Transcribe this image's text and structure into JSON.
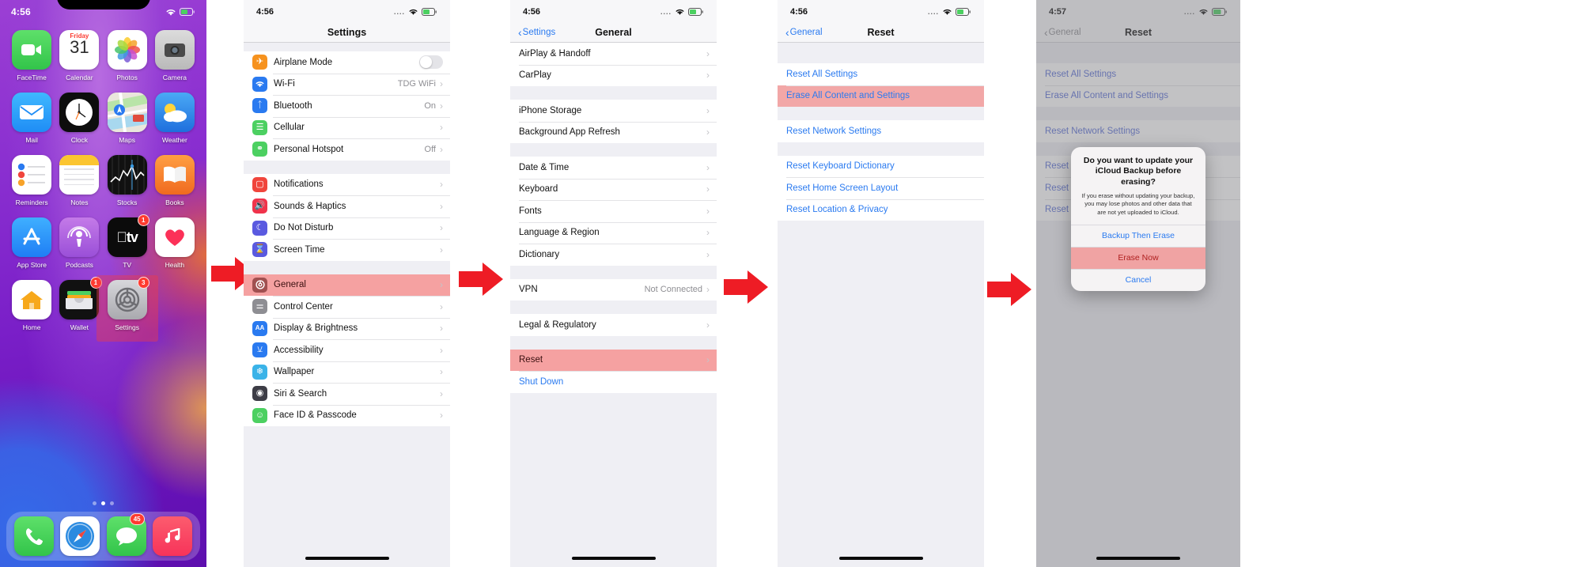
{
  "phone1": {
    "name": "home-screen",
    "status": {
      "time": "4:56",
      "wifi_icon": "wifi-icon",
      "battery_icon": "battery-icon"
    },
    "apps": [
      {
        "label": "FaceTime",
        "icon": "facetime-icon"
      },
      {
        "label": "Calendar",
        "icon": "calendar-icon",
        "weekday": "Friday",
        "day": "31"
      },
      {
        "label": "Photos",
        "icon": "photos-icon"
      },
      {
        "label": "Camera",
        "icon": "camera-icon"
      },
      {
        "label": "Mail",
        "icon": "mail-icon"
      },
      {
        "label": "Clock",
        "icon": "clock-icon"
      },
      {
        "label": "Maps",
        "icon": "maps-icon"
      },
      {
        "label": "Weather",
        "icon": "weather-icon"
      },
      {
        "label": "Reminders",
        "icon": "reminders-icon"
      },
      {
        "label": "Notes",
        "icon": "notes-icon"
      },
      {
        "label": "Stocks",
        "icon": "stocks-icon"
      },
      {
        "label": "Books",
        "icon": "books-icon"
      },
      {
        "label": "App Store",
        "icon": "appstore-icon"
      },
      {
        "label": "Podcasts",
        "icon": "podcasts-icon"
      },
      {
        "label": "TV",
        "icon": "tv-icon",
        "badge": "1"
      },
      {
        "label": "Health",
        "icon": "health-icon"
      },
      {
        "label": "Home",
        "icon": "home-icon"
      },
      {
        "label": "Wallet",
        "icon": "wallet-icon",
        "badge": "1"
      },
      {
        "label": "Settings",
        "icon": "settings-icon",
        "badge": "3",
        "highlighted": true
      }
    ],
    "dock": [
      {
        "label": "Phone",
        "icon": "phone-icon"
      },
      {
        "label": "Safari",
        "icon": "safari-icon"
      },
      {
        "label": "Messages",
        "icon": "messages-icon",
        "badge": "45"
      },
      {
        "label": "Music",
        "icon": "music-icon"
      }
    ],
    "page_dots": {
      "count": 3,
      "active_index": 1
    }
  },
  "phone2": {
    "name": "settings-screen",
    "status": {
      "time": "4:56"
    },
    "nav": {
      "title": "Settings",
      "back": ""
    },
    "groups": [
      {
        "rows": [
          {
            "label": "Airplane Mode",
            "icon": "airplane-icon",
            "control": "toggle",
            "toggle_on": false
          },
          {
            "label": "Wi-Fi",
            "icon": "wifi-icon",
            "value": "TDG WiFi"
          },
          {
            "label": "Bluetooth",
            "icon": "bluetooth-icon",
            "value": "On"
          },
          {
            "label": "Cellular",
            "icon": "cellular-icon",
            "value": ""
          },
          {
            "label": "Personal Hotspot",
            "icon": "hotspot-icon",
            "value": "Off"
          }
        ]
      },
      {
        "rows": [
          {
            "label": "Notifications",
            "icon": "notifications-icon"
          },
          {
            "label": "Sounds & Haptics",
            "icon": "sounds-icon"
          },
          {
            "label": "Do Not Disturb",
            "icon": "dnd-icon"
          },
          {
            "label": "Screen Time",
            "icon": "screentime-icon"
          }
        ]
      },
      {
        "rows": [
          {
            "label": "General",
            "icon": "general-icon",
            "highlighted": true
          },
          {
            "label": "Control Center",
            "icon": "controlcenter-icon"
          },
          {
            "label": "Display & Brightness",
            "icon": "display-icon"
          },
          {
            "label": "Accessibility",
            "icon": "accessibility-icon"
          },
          {
            "label": "Wallpaper",
            "icon": "wallpaper-icon"
          },
          {
            "label": "Siri & Search",
            "icon": "siri-icon"
          },
          {
            "label": "Face ID & Passcode",
            "icon": "faceid-icon"
          }
        ]
      }
    ]
  },
  "phone3": {
    "name": "general-screen",
    "status": {
      "time": "4:56"
    },
    "nav": {
      "title": "General",
      "back": "Settings"
    },
    "groups": [
      {
        "rows": [
          {
            "label": "AirPlay & Handoff"
          },
          {
            "label": "CarPlay"
          }
        ]
      },
      {
        "rows": [
          {
            "label": "iPhone Storage"
          },
          {
            "label": "Background App Refresh"
          }
        ]
      },
      {
        "rows": [
          {
            "label": "Date & Time"
          },
          {
            "label": "Keyboard"
          },
          {
            "label": "Fonts"
          },
          {
            "label": "Language & Region"
          },
          {
            "label": "Dictionary"
          }
        ]
      },
      {
        "rows": [
          {
            "label": "VPN",
            "value": "Not Connected"
          }
        ]
      },
      {
        "rows": [
          {
            "label": "Legal & Regulatory"
          }
        ]
      },
      {
        "rows": [
          {
            "label": "Reset",
            "highlighted": true
          },
          {
            "label": "Shut Down",
            "style": "blue"
          }
        ]
      }
    ]
  },
  "phone4": {
    "name": "reset-screen",
    "status": {
      "time": "4:56"
    },
    "nav": {
      "title": "Reset",
      "back": "General"
    },
    "groups": [
      {
        "rows": [
          {
            "label": "Reset All Settings",
            "style": "blue"
          },
          {
            "label": "Erase All Content and Settings",
            "style": "blue",
            "highlighted": true
          }
        ]
      },
      {
        "rows": [
          {
            "label": "Reset Network Settings",
            "style": "blue"
          }
        ]
      },
      {
        "rows": [
          {
            "label": "Reset Keyboard Dictionary",
            "style": "blue"
          },
          {
            "label": "Reset Home Screen Layout",
            "style": "blue"
          },
          {
            "label": "Reset Location & Privacy",
            "style": "blue"
          }
        ]
      }
    ]
  },
  "phone5": {
    "name": "reset-screen-with-alert",
    "status": {
      "time": "4:57"
    },
    "nav": {
      "title": "Reset",
      "back": "General"
    },
    "groups": [
      {
        "rows": [
          {
            "label": "Reset All Settings",
            "style": "blue"
          },
          {
            "label": "Erase All Content and Settings",
            "style": "blue"
          }
        ]
      },
      {
        "rows": [
          {
            "label": "Reset Network Settings",
            "style": "blue"
          }
        ]
      },
      {
        "rows": [
          {
            "label": "Reset Keyboard Dictionary",
            "style": "blue"
          },
          {
            "label": "Reset Home Screen Layout",
            "style": "blue"
          },
          {
            "label": "Reset Location & Privacy",
            "style": "blue"
          }
        ]
      }
    ],
    "alert": {
      "title": "Do you want to update your iCloud Backup before erasing?",
      "message": "If you erase without updating your backup, you may lose photos and other data that are not yet uploaded to iCloud.",
      "buttons": [
        {
          "label": "Backup Then Erase",
          "style": "normal"
        },
        {
          "label": "Erase Now",
          "style": "danger"
        },
        {
          "label": "Cancel",
          "style": "normal"
        }
      ]
    }
  },
  "colors": {
    "arrow_red": "#ee1c25",
    "ios_blue": "#2a7af0",
    "highlight_pink": "#f5a1a1",
    "ios_gray_bg": "#efeff4"
  }
}
